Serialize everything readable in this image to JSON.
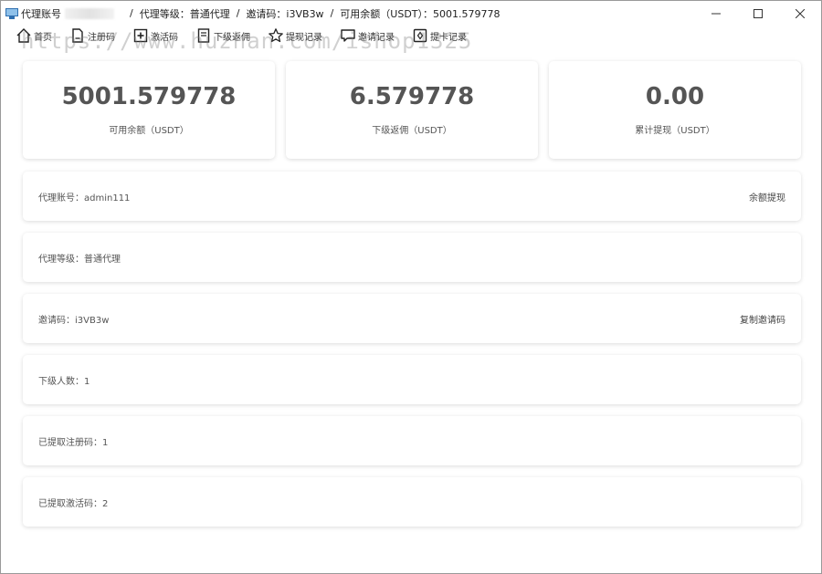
{
  "window": {
    "title_prefix": "代理账号",
    "segments": [
      "代理等级：普通代理",
      "邀请码：i3VB3w",
      "可用余额（USDT）：5001.579778"
    ],
    "separator": "/"
  },
  "toolbar": {
    "items": [
      {
        "label": "首页",
        "icon": "home-icon"
      },
      {
        "label": "注册码",
        "icon": "document-icon"
      },
      {
        "label": "激活码",
        "icon": "plus-box-icon"
      },
      {
        "label": "下级返佣",
        "icon": "list-icon"
      },
      {
        "label": "提现记录",
        "icon": "star-icon"
      },
      {
        "label": "邀请记录",
        "icon": "chat-icon"
      },
      {
        "label": "提卡记录",
        "icon": "card-icon"
      }
    ]
  },
  "watermark": "https://www.huzhan.com/ishop1325",
  "stats": [
    {
      "value": "5001.579778",
      "label": "可用余额（USDT）"
    },
    {
      "value": "6.579778",
      "label": "下级返佣（USDT）"
    },
    {
      "value": "0.00",
      "label": "累计提现（USDT）"
    }
  ],
  "rows": [
    {
      "text": "代理账号：admin111",
      "action": "余额提现"
    },
    {
      "text": "代理等级：普通代理",
      "action": ""
    },
    {
      "text": "邀请码：i3VB3w",
      "action": "复制邀请码"
    },
    {
      "text": "下级人数：1",
      "action": ""
    },
    {
      "text": "已提取注册码：1",
      "action": ""
    },
    {
      "text": "已提取激活码：2",
      "action": ""
    }
  ]
}
